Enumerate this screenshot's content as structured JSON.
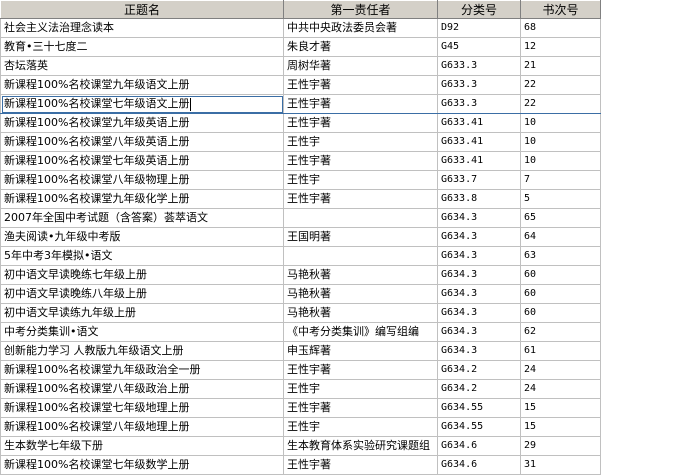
{
  "columns": [
    "正题名",
    "第一责任者",
    "分类号",
    "书次号"
  ],
  "rows": [
    [
      "社会主义法治理念读本",
      "中共中央政法委员会著",
      "D92",
      "68"
    ],
    [
      "教育•三十七度二",
      "朱良才著",
      "G45",
      "12"
    ],
    [
      "杏坛落英",
      "周树华著",
      "G633.3",
      "21"
    ],
    [
      "新课程100%名校课堂九年级语文上册",
      "王性宇著",
      "G633.3",
      "22"
    ],
    [
      "新课程100%名校课堂七年级语文上册",
      "王性宇著",
      "G633.3",
      "22"
    ],
    [
      "新课程100%名校课堂九年级英语上册",
      "王性宇著",
      "G633.41",
      "10"
    ],
    [
      "新课程100%名校课堂八年级英语上册",
      "王性宇",
      "G633.41",
      "10"
    ],
    [
      "新课程100%名校课堂七年级英语上册",
      "王性宇著",
      "G633.41",
      "10"
    ],
    [
      "新课程100%名校课堂八年级物理上册",
      "王性宇",
      "G633.7",
      "7"
    ],
    [
      "新课程100%名校课堂九年级化学上册",
      "王性宇著",
      "G633.8",
      "5"
    ],
    [
      "2007年全国中考试题（含答案）荟萃语文",
      "",
      "G634.3",
      "65"
    ],
    [
      "渔夫阅读•九年级中考版",
      "王国明著",
      "G634.3",
      "64"
    ],
    [
      "5年中考3年模拟•语文",
      "",
      "G634.3",
      "63"
    ],
    [
      "初中语文早读晚练七年级上册",
      "马艳秋著",
      "G634.3",
      "60"
    ],
    [
      "初中语文早读晚练八年级上册",
      "马艳秋著",
      "G634.3",
      "60"
    ],
    [
      "初中语文早读练九年级上册",
      "马艳秋著",
      "G634.3",
      "60"
    ],
    [
      "中考分类集训•语文",
      "《中考分类集训》编写组编",
      "G634.3",
      "62"
    ],
    [
      "创新能力学习  人教版九年级语文上册",
      "申玉辉著",
      "G634.3",
      "61"
    ],
    [
      "新课程100%名校课堂九年级政治全一册",
      "王性宇著",
      "G634.2",
      "24"
    ],
    [
      "新课程100%名校课堂八年级政治上册",
      "王性宇",
      "G634.2",
      "24"
    ],
    [
      "新课程100%名校课堂七年级地理上册",
      "王性宇著",
      "G634.55",
      "15"
    ],
    [
      "新课程100%名校课堂八年级地理上册",
      "王性宇",
      "G634.55",
      "15"
    ],
    [
      "生本数学七年级下册",
      "生本教育体系实验研究课题组",
      "G634.6",
      "29"
    ],
    [
      "新课程100%名校课堂七年级数学上册",
      "王性宇著",
      "G634.6",
      "31"
    ]
  ],
  "selected_row": 4
}
